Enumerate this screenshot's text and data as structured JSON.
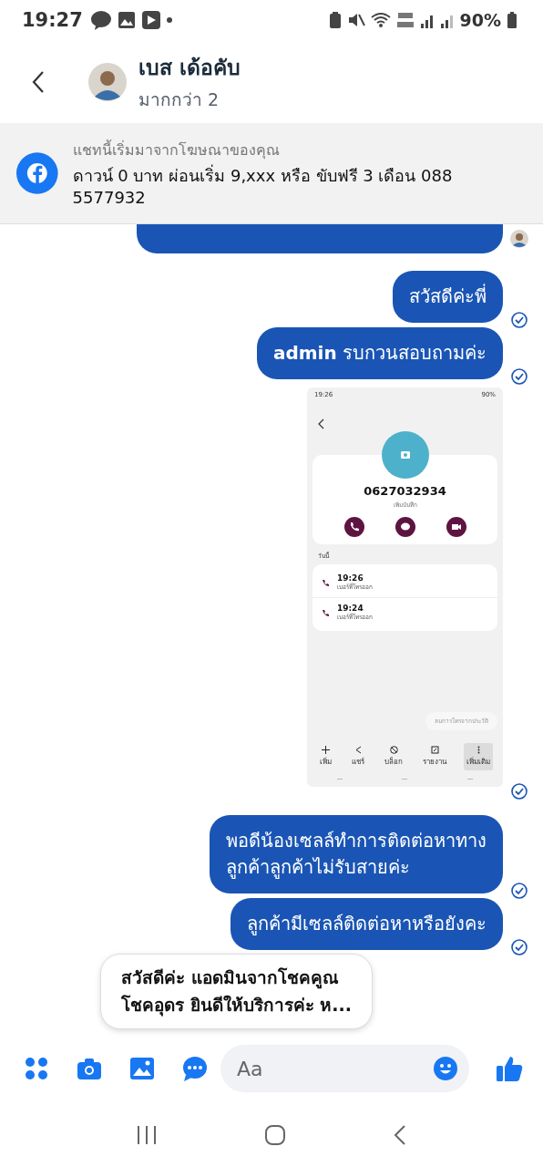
{
  "status_bar": {
    "time": "19:27",
    "battery": "90%"
  },
  "header": {
    "name": "เบส เด้อคับ",
    "subtitle": "มากกว่า 2"
  },
  "ad_banner": {
    "caption": "แชทนี้เริ่มมาจากโฆษณาของคุณ",
    "text": "ดาวน์ 0 บาท ผ่อนเริ่ม 9,xxx หรือ ขับฟรี 3 เดือน  088 5577932"
  },
  "messages": [
    {
      "kind": "fragment",
      "seen": true
    },
    {
      "kind": "text",
      "text": "สวัสดีค่ะพี่",
      "seen": false
    },
    {
      "kind": "text",
      "text": "**admin** รบกวนสอบถามค่ะ",
      "seen": false
    },
    {
      "kind": "screenshot",
      "seen": false,
      "shot": {
        "time": "19:26",
        "battery": "90%",
        "number": "0627032934",
        "note": "เพิ่มบันทึก",
        "section": "วันนี้",
        "calls": [
          {
            "time": "19:26",
            "type": "เบอร์ที่โทรออก"
          },
          {
            "time": "19:24",
            "type": "เบอร์ที่โทรออก"
          }
        ],
        "delete": "ลบการโทรจากประวัติ",
        "actions": [
          {
            "label": "เพิ่ม",
            "selected": false
          },
          {
            "label": "แชร์",
            "selected": false
          },
          {
            "label": "บล็อก",
            "selected": false
          },
          {
            "label": "รายงาน",
            "selected": false
          },
          {
            "label": "เพิ่มเติม",
            "selected": true
          }
        ]
      }
    },
    {
      "kind": "text",
      "text": "พอดีน้องเซลล์ทำการติดต่อหาทาง\nลูกค้าลูกค้าไม่รับสายค่ะ",
      "seen": false
    },
    {
      "kind": "text",
      "text": "ลูกค้ามีเซลล์ติดต่อหาหรือยังคะ",
      "seen": false
    }
  ],
  "quick_reply": "สวัสดีค่ะ แอดมินจากโชคคูณ\nโชคอุดร ยินดีให้บริการค่ะ ห...",
  "composer": {
    "placeholder": "Aa"
  }
}
